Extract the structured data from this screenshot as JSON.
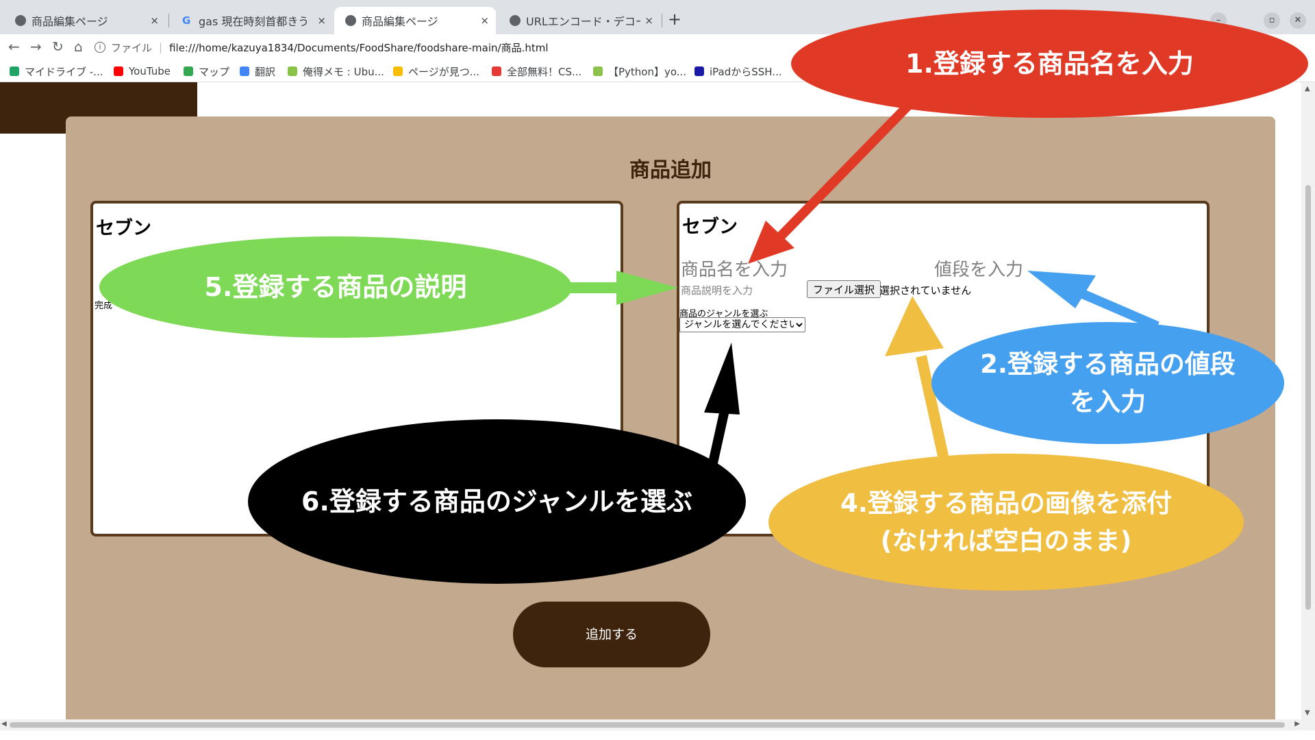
{
  "browser": {
    "tabs": [
      {
        "title": "商品編集ページ"
      },
      {
        "title": "gas 現在時刻首都きう - Goo"
      },
      {
        "title": "商品編集ページ"
      },
      {
        "title": "URLエンコード・デコード"
      }
    ],
    "tab_close": "×",
    "new_tab": "+",
    "address": {
      "scheme": "ファイル",
      "url": "file:///home/kazuya1834/Documents/FoodShare/foodshare-main/商品.html"
    },
    "bookmarks": [
      {
        "label": "マイドライブ -...",
        "color": "#1fa463"
      },
      {
        "label": "YouTube",
        "color": "#ff0000"
      },
      {
        "label": "マップ",
        "color": "#34a853"
      },
      {
        "label": "翻訳",
        "color": "#4285f4"
      },
      {
        "label": "俺得メモ : Ubu...",
        "color": "#8bc34a"
      },
      {
        "label": "ページが見つ...",
        "color": "#fbbc04"
      },
      {
        "label": "全部無料！CS...",
        "color": "#e53935"
      },
      {
        "label": "【Python】yo...",
        "color": "#8bc34a"
      },
      {
        "label": "iPadからSSH...",
        "color": "#1a1aa6"
      }
    ]
  },
  "page": {
    "section_title": "商品追加",
    "colors": {
      "brown_dark": "#3e240d",
      "panel": "#c3a98d"
    },
    "preview_card": {
      "store": "セブン",
      "complete_text": "完成"
    },
    "edit_card": {
      "store": "セブン",
      "name_placeholder": "商品名を入力",
      "price_placeholder": "値段を入力",
      "description_placeholder": "商品説明を入力",
      "file_button": "ファイル選択",
      "file_status": "選択されていません",
      "genre_label": "商品のジャンルを選ぶ",
      "genre_selected": "ジャンルを選んでください"
    },
    "add_button": "追加する"
  },
  "annotations": [
    {
      "text": "1.登録する商品名を入力",
      "color": "#e03a26"
    },
    {
      "text": "2.登録する商品の値段を入力",
      "color": "#45a0f0"
    },
    {
      "text": "4.登録する商品の画像を添付(なければ空白のまま)",
      "color": "#f0be40"
    },
    {
      "text": "5.登録する商品の説明",
      "color": "#7ed957"
    },
    {
      "text": "6.登録する商品のジャンルを選ぶ",
      "color": "#000000"
    }
  ]
}
